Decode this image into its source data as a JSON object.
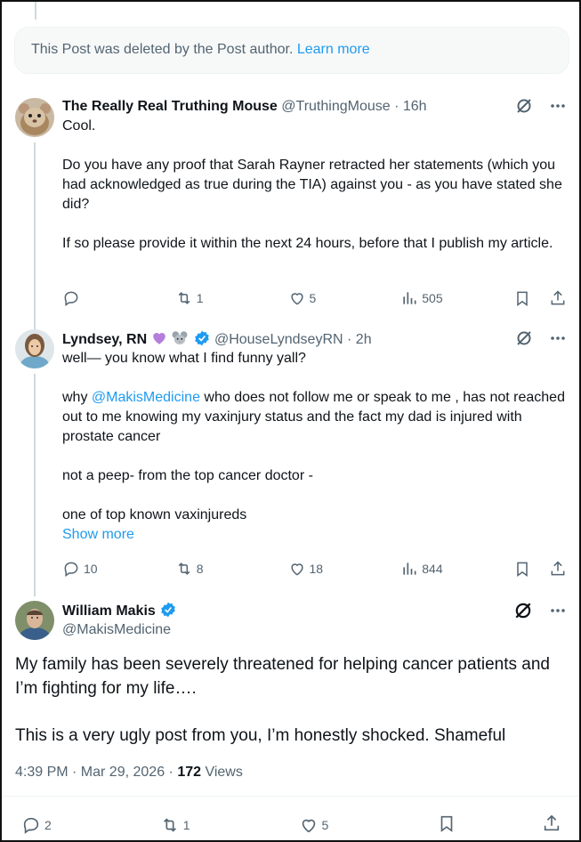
{
  "deleted_notice": {
    "text": "This Post was deleted by the Post author.",
    "link": "Learn more"
  },
  "posts": [
    {
      "name": "The Really Real Truthing Mouse",
      "handle": "@TruthingMouse",
      "time": "· 16h",
      "paragraphs": [
        "Cool.",
        "Do you have any proof that Sarah Rayner retracted her statements (which you had acknowledged as true during the TIA) against you - as you have stated she did?",
        "If so please provide it within the next 24 hours, before that I publish my article."
      ],
      "replies": "",
      "reposts": "1",
      "likes": "5",
      "views": "505"
    },
    {
      "name": "Lyndsey, RN",
      "handle": "@HouseLyndseyRN",
      "time": "· 2h",
      "line1": "well— you know what I find funny yall?",
      "line2_prefix": "why ",
      "line2_mention": "@MakisMedicine",
      "line2_rest": " who does not follow me or speak to me , has not reached out to me knowing my vaxinjury status and the fact my dad is injured with prostate cancer",
      "line3": "not a peep- from the top cancer doctor -",
      "line4": "one of top known vaxinjureds",
      "show_more": "Show more",
      "replies": "10",
      "reposts": "8",
      "likes": "18",
      "views": "844"
    }
  ],
  "main_post": {
    "name": "William Makis",
    "handle": "@MakisMedicine",
    "line1": "My family has been severely threatened for helping cancer patients and I’m fighting for my life….",
    "line2": "This is a very ugly post from you, I’m honestly shocked. Shameful",
    "timestamp": "4:39 PM · Mar 29, 2026 · ",
    "views_count": "172",
    "views_label": " Views",
    "replies": "2",
    "reposts": "1",
    "likes": "5"
  },
  "colors": {
    "accent": "#1d9bf0",
    "secondary_text": "#536471",
    "verified": "#1d9bf0",
    "emoji_heart": "#b57edc"
  }
}
